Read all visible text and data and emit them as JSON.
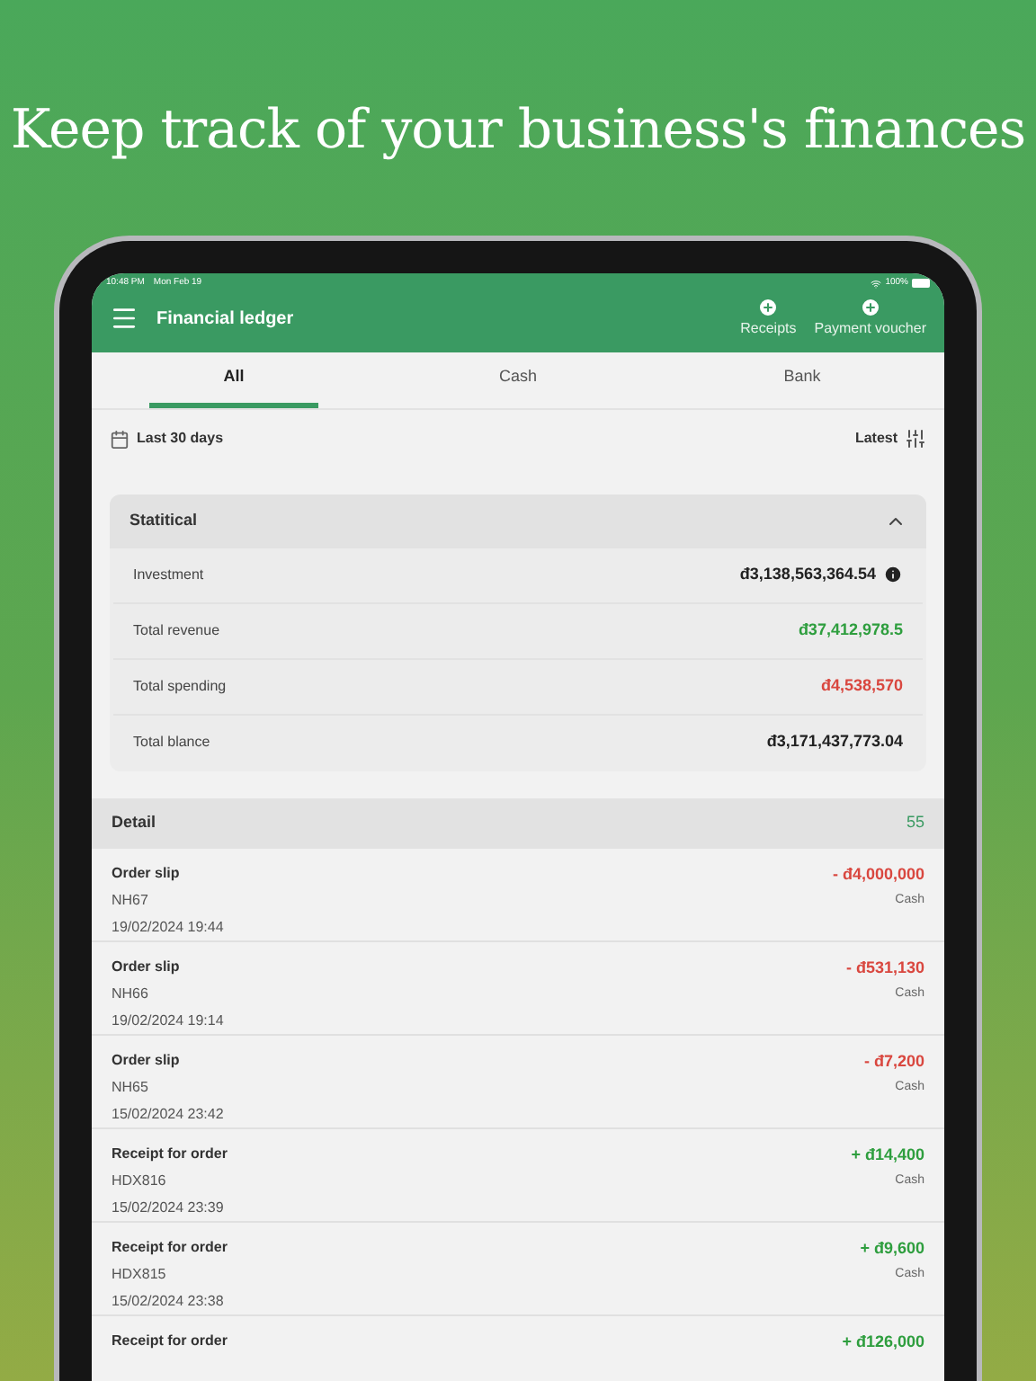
{
  "headline": "Keep track of your business's finances",
  "status_bar": {
    "time": "10:48 PM",
    "date": "Mon Feb 19",
    "battery": "100%"
  },
  "app_bar": {
    "title": "Financial ledger",
    "actions": [
      {
        "label": "Receipts"
      },
      {
        "label": "Payment voucher"
      }
    ]
  },
  "tabs": [
    {
      "label": "All",
      "selected": true
    },
    {
      "label": "Cash",
      "selected": false
    },
    {
      "label": "Bank",
      "selected": false
    }
  ],
  "filter": {
    "period": "Last 30 days",
    "sort": "Latest"
  },
  "statistics": {
    "title": "Statitical",
    "expanded": true,
    "rows": [
      {
        "label": "Investment",
        "value": "đ3,138,563,364.54",
        "kind": "neutral",
        "info": true
      },
      {
        "label": "Total revenue",
        "value": "đ37,412,978.5",
        "kind": "income"
      },
      {
        "label": "Total spending",
        "value": "đ4,538,570",
        "kind": "expense"
      },
      {
        "label": "Total blance",
        "value": "đ3,171,437,773.04",
        "kind": "neutral"
      }
    ]
  },
  "detail": {
    "title": "Detail",
    "count": "55",
    "entries": [
      {
        "title": "Order slip",
        "code": "NH67",
        "time": "19/02/2024 19:44",
        "amount": "- đ4,000,000",
        "kind": "expense",
        "account": "Cash"
      },
      {
        "title": "Order slip",
        "code": "NH66",
        "time": "19/02/2024 19:14",
        "amount": "- đ531,130",
        "kind": "expense",
        "account": "Cash"
      },
      {
        "title": "Order slip",
        "code": "NH65",
        "time": "15/02/2024 23:42",
        "amount": "- đ7,200",
        "kind": "expense",
        "account": "Cash"
      },
      {
        "title": "Receipt for order",
        "code": "HDX816",
        "time": "15/02/2024 23:39",
        "amount": "+ đ14,400",
        "kind": "income",
        "account": "Cash"
      },
      {
        "title": "Receipt for order",
        "code": "HDX815",
        "time": "15/02/2024 23:38",
        "amount": "+ đ9,600",
        "kind": "income",
        "account": "Cash"
      },
      {
        "title": "Receipt for order",
        "amount": "+ đ126,000",
        "kind": "income"
      }
    ]
  }
}
